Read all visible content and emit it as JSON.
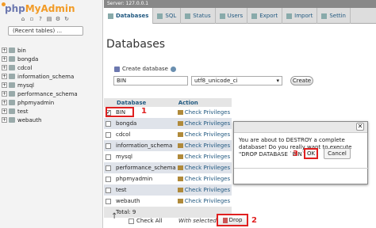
{
  "app": {
    "logo_php": "php",
    "logo_myadmin": "MyAdmin",
    "server_label": "Server: 127.0.0.1"
  },
  "sidebar": {
    "recent_tables": "(Recent tables) ...",
    "databases": [
      "bin",
      "bongda",
      "cdcol",
      "information_schema",
      "mysql",
      "performance_schema",
      "phpmyadmin",
      "test",
      "webauth"
    ]
  },
  "tabs": [
    {
      "label": "Databases",
      "active": true
    },
    {
      "label": "SQL"
    },
    {
      "label": "Status"
    },
    {
      "label": "Users"
    },
    {
      "label": "Export"
    },
    {
      "label": "Import"
    },
    {
      "label": "Settin"
    }
  ],
  "main": {
    "heading": "Databases",
    "create_label": "Create database",
    "db_name_value": "BIN",
    "collation_value": "utf8_unicode_ci",
    "create_button": "Create"
  },
  "table": {
    "col_database": "Database",
    "col_action": "Action",
    "action_text": "Check Privileges",
    "rows": [
      {
        "name": "BIN",
        "checked": true
      },
      {
        "name": "bongda",
        "checked": false
      },
      {
        "name": "cdcol",
        "checked": false
      },
      {
        "name": "information_schema",
        "checked": false
      },
      {
        "name": "mysql",
        "checked": false
      },
      {
        "name": "performance_schema",
        "checked": false
      },
      {
        "name": "phpmyadmin",
        "checked": false
      },
      {
        "name": "test",
        "checked": false
      },
      {
        "name": "webauth",
        "checked": false
      }
    ],
    "total": "Total: 9"
  },
  "footer": {
    "check_all": "Check All",
    "with_selected": "With selected:",
    "drop": "Drop"
  },
  "dialog": {
    "message": "You are about to DESTROY a complete database! Do you really want to execute \"DROP DATABASE `BIN`;\"?",
    "ok": "OK",
    "cancel": "Cancel"
  },
  "annotations": {
    "step1": "1",
    "step2": "2",
    "step3": "3"
  },
  "colors": {
    "highlight": "#e02020",
    "link": "#235a81"
  }
}
